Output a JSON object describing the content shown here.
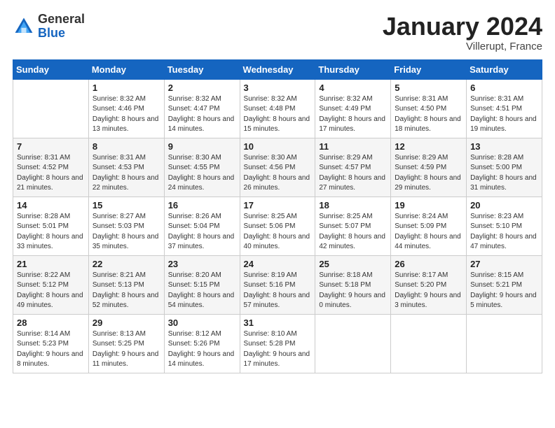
{
  "logo": {
    "general": "General",
    "blue": "Blue"
  },
  "header": {
    "month": "January 2024",
    "location": "Villerupt, France"
  },
  "weekdays": [
    "Sunday",
    "Monday",
    "Tuesday",
    "Wednesday",
    "Thursday",
    "Friday",
    "Saturday"
  ],
  "weeks": [
    [
      {
        "day": "",
        "sunrise": "",
        "sunset": "",
        "daylight": ""
      },
      {
        "day": "1",
        "sunrise": "Sunrise: 8:32 AM",
        "sunset": "Sunset: 4:46 PM",
        "daylight": "Daylight: 8 hours and 13 minutes."
      },
      {
        "day": "2",
        "sunrise": "Sunrise: 8:32 AM",
        "sunset": "Sunset: 4:47 PM",
        "daylight": "Daylight: 8 hours and 14 minutes."
      },
      {
        "day": "3",
        "sunrise": "Sunrise: 8:32 AM",
        "sunset": "Sunset: 4:48 PM",
        "daylight": "Daylight: 8 hours and 15 minutes."
      },
      {
        "day": "4",
        "sunrise": "Sunrise: 8:32 AM",
        "sunset": "Sunset: 4:49 PM",
        "daylight": "Daylight: 8 hours and 17 minutes."
      },
      {
        "day": "5",
        "sunrise": "Sunrise: 8:31 AM",
        "sunset": "Sunset: 4:50 PM",
        "daylight": "Daylight: 8 hours and 18 minutes."
      },
      {
        "day": "6",
        "sunrise": "Sunrise: 8:31 AM",
        "sunset": "Sunset: 4:51 PM",
        "daylight": "Daylight: 8 hours and 19 minutes."
      }
    ],
    [
      {
        "day": "7",
        "sunrise": "Sunrise: 8:31 AM",
        "sunset": "Sunset: 4:52 PM",
        "daylight": "Daylight: 8 hours and 21 minutes."
      },
      {
        "day": "8",
        "sunrise": "Sunrise: 8:31 AM",
        "sunset": "Sunset: 4:53 PM",
        "daylight": "Daylight: 8 hours and 22 minutes."
      },
      {
        "day": "9",
        "sunrise": "Sunrise: 8:30 AM",
        "sunset": "Sunset: 4:55 PM",
        "daylight": "Daylight: 8 hours and 24 minutes."
      },
      {
        "day": "10",
        "sunrise": "Sunrise: 8:30 AM",
        "sunset": "Sunset: 4:56 PM",
        "daylight": "Daylight: 8 hours and 26 minutes."
      },
      {
        "day": "11",
        "sunrise": "Sunrise: 8:29 AM",
        "sunset": "Sunset: 4:57 PM",
        "daylight": "Daylight: 8 hours and 27 minutes."
      },
      {
        "day": "12",
        "sunrise": "Sunrise: 8:29 AM",
        "sunset": "Sunset: 4:59 PM",
        "daylight": "Daylight: 8 hours and 29 minutes."
      },
      {
        "day": "13",
        "sunrise": "Sunrise: 8:28 AM",
        "sunset": "Sunset: 5:00 PM",
        "daylight": "Daylight: 8 hours and 31 minutes."
      }
    ],
    [
      {
        "day": "14",
        "sunrise": "Sunrise: 8:28 AM",
        "sunset": "Sunset: 5:01 PM",
        "daylight": "Daylight: 8 hours and 33 minutes."
      },
      {
        "day": "15",
        "sunrise": "Sunrise: 8:27 AM",
        "sunset": "Sunset: 5:03 PM",
        "daylight": "Daylight: 8 hours and 35 minutes."
      },
      {
        "day": "16",
        "sunrise": "Sunrise: 8:26 AM",
        "sunset": "Sunset: 5:04 PM",
        "daylight": "Daylight: 8 hours and 37 minutes."
      },
      {
        "day": "17",
        "sunrise": "Sunrise: 8:25 AM",
        "sunset": "Sunset: 5:06 PM",
        "daylight": "Daylight: 8 hours and 40 minutes."
      },
      {
        "day": "18",
        "sunrise": "Sunrise: 8:25 AM",
        "sunset": "Sunset: 5:07 PM",
        "daylight": "Daylight: 8 hours and 42 minutes."
      },
      {
        "day": "19",
        "sunrise": "Sunrise: 8:24 AM",
        "sunset": "Sunset: 5:09 PM",
        "daylight": "Daylight: 8 hours and 44 minutes."
      },
      {
        "day": "20",
        "sunrise": "Sunrise: 8:23 AM",
        "sunset": "Sunset: 5:10 PM",
        "daylight": "Daylight: 8 hours and 47 minutes."
      }
    ],
    [
      {
        "day": "21",
        "sunrise": "Sunrise: 8:22 AM",
        "sunset": "Sunset: 5:12 PM",
        "daylight": "Daylight: 8 hours and 49 minutes."
      },
      {
        "day": "22",
        "sunrise": "Sunrise: 8:21 AM",
        "sunset": "Sunset: 5:13 PM",
        "daylight": "Daylight: 8 hours and 52 minutes."
      },
      {
        "day": "23",
        "sunrise": "Sunrise: 8:20 AM",
        "sunset": "Sunset: 5:15 PM",
        "daylight": "Daylight: 8 hours and 54 minutes."
      },
      {
        "day": "24",
        "sunrise": "Sunrise: 8:19 AM",
        "sunset": "Sunset: 5:16 PM",
        "daylight": "Daylight: 8 hours and 57 minutes."
      },
      {
        "day": "25",
        "sunrise": "Sunrise: 8:18 AM",
        "sunset": "Sunset: 5:18 PM",
        "daylight": "Daylight: 9 hours and 0 minutes."
      },
      {
        "day": "26",
        "sunrise": "Sunrise: 8:17 AM",
        "sunset": "Sunset: 5:20 PM",
        "daylight": "Daylight: 9 hours and 3 minutes."
      },
      {
        "day": "27",
        "sunrise": "Sunrise: 8:15 AM",
        "sunset": "Sunset: 5:21 PM",
        "daylight": "Daylight: 9 hours and 5 minutes."
      }
    ],
    [
      {
        "day": "28",
        "sunrise": "Sunrise: 8:14 AM",
        "sunset": "Sunset: 5:23 PM",
        "daylight": "Daylight: 9 hours and 8 minutes."
      },
      {
        "day": "29",
        "sunrise": "Sunrise: 8:13 AM",
        "sunset": "Sunset: 5:25 PM",
        "daylight": "Daylight: 9 hours and 11 minutes."
      },
      {
        "day": "30",
        "sunrise": "Sunrise: 8:12 AM",
        "sunset": "Sunset: 5:26 PM",
        "daylight": "Daylight: 9 hours and 14 minutes."
      },
      {
        "day": "31",
        "sunrise": "Sunrise: 8:10 AM",
        "sunset": "Sunset: 5:28 PM",
        "daylight": "Daylight: 9 hours and 17 minutes."
      },
      {
        "day": "",
        "sunrise": "",
        "sunset": "",
        "daylight": ""
      },
      {
        "day": "",
        "sunrise": "",
        "sunset": "",
        "daylight": ""
      },
      {
        "day": "",
        "sunrise": "",
        "sunset": "",
        "daylight": ""
      }
    ]
  ]
}
